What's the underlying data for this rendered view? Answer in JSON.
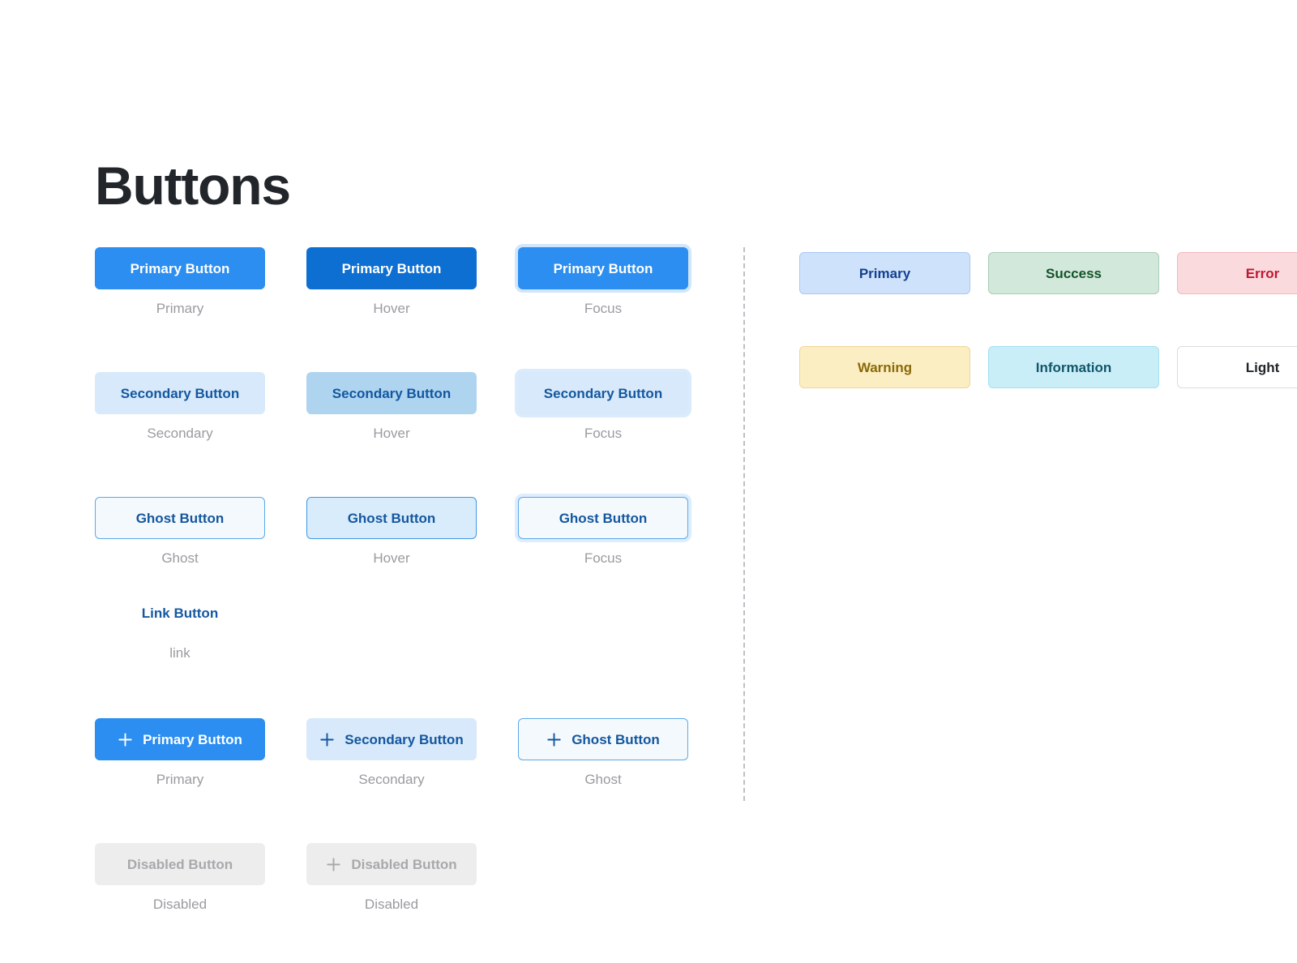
{
  "page": {
    "title": "Buttons",
    "background_color": "#ffffff",
    "title_color": "#22262b",
    "divider_color": "#bcbfc4"
  },
  "colors": {
    "primary": "#2b8ef0",
    "primary_hover": "#0d6fd1",
    "secondary_bg": "#d7e9fb",
    "secondary_hover_bg": "#aed4f0",
    "secondary_text": "#14579f",
    "ghost_bg": "#f4f9fe",
    "ghost_border": "#5ba8e8",
    "link_text": "#15589f",
    "disabled_bg": "#ededed",
    "disabled_text": "#a9a9ad",
    "caption_text": "#9a9ba0"
  },
  "button_groups": [
    {
      "name": "primary-states",
      "buttons": [
        {
          "label": "Primary Button",
          "caption": "Primary",
          "variant": "primary",
          "state": "default",
          "icon": null,
          "disabled": false
        },
        {
          "label": "Primary Button",
          "caption": "Hover",
          "variant": "primary",
          "state": "hover",
          "icon": null,
          "disabled": false
        },
        {
          "label": "Primary Button",
          "caption": "Focus",
          "variant": "primary",
          "state": "focus",
          "icon": null,
          "disabled": false
        }
      ]
    },
    {
      "name": "secondary-states",
      "buttons": [
        {
          "label": "Secondary Button",
          "caption": "Secondary",
          "variant": "secondary",
          "state": "default",
          "icon": null,
          "disabled": false
        },
        {
          "label": "Secondary Button",
          "caption": "Hover",
          "variant": "secondary",
          "state": "hover",
          "icon": null,
          "disabled": false
        },
        {
          "label": "Secondary Button",
          "caption": "Focus",
          "variant": "secondary",
          "state": "focus",
          "icon": null,
          "disabled": false
        }
      ]
    },
    {
      "name": "ghost-states",
      "buttons": [
        {
          "label": "Ghost Button",
          "caption": "Ghost",
          "variant": "ghost",
          "state": "default",
          "icon": null,
          "disabled": false
        },
        {
          "label": "Ghost Button",
          "caption": "Hover",
          "variant": "ghost",
          "state": "hover",
          "icon": null,
          "disabled": false
        },
        {
          "label": "Ghost Button",
          "caption": "Focus",
          "variant": "ghost",
          "state": "focus",
          "icon": null,
          "disabled": false
        }
      ]
    },
    {
      "name": "link-state",
      "buttons": [
        {
          "label": "Link Button",
          "caption": "link",
          "variant": "link",
          "state": "default",
          "icon": null,
          "disabled": false
        }
      ]
    },
    {
      "name": "icon-buttons",
      "buttons": [
        {
          "label": "Primary Button",
          "caption": "Primary",
          "variant": "primary",
          "state": "default",
          "icon": "plus-icon",
          "disabled": false
        },
        {
          "label": "Secondary Button",
          "caption": "Secondary",
          "variant": "secondary",
          "state": "default",
          "icon": "plus-icon",
          "disabled": false
        },
        {
          "label": "Ghost Button",
          "caption": "Ghost",
          "variant": "ghost",
          "state": "default",
          "icon": "plus-icon",
          "disabled": false
        }
      ]
    },
    {
      "name": "disabled-buttons",
      "buttons": [
        {
          "label": "Disabled Button",
          "caption": "Disabled",
          "variant": "disabled",
          "state": "disabled",
          "icon": null,
          "disabled": true
        },
        {
          "label": "Disabled Button",
          "caption": "Disabled",
          "variant": "disabled",
          "state": "disabled",
          "icon": "plus-icon",
          "disabled": true
        }
      ]
    }
  ],
  "status_badges": {
    "rows": [
      [
        {
          "label": "Primary",
          "variant": "primary",
          "bg": "#cfe2fc",
          "border": "#a9c8f4",
          "text": "#13418f"
        },
        {
          "label": "Success",
          "variant": "success",
          "bg": "#d2e8da",
          "border": "#a9cdb7",
          "text": "#14532a"
        },
        {
          "label": "Error",
          "variant": "error",
          "bg": "#fadadd",
          "border": "#f2b9bf",
          "text": "#c01730"
        }
      ],
      [
        {
          "label": "Warning",
          "variant": "warning",
          "bg": "#fbeec2",
          "border": "#efd796",
          "text": "#8a6a08"
        },
        {
          "label": "Information",
          "variant": "information",
          "bg": "#caeef7",
          "border": "#a3e0ef",
          "text": "#12566b"
        },
        {
          "label": "Light",
          "variant": "light",
          "bg": "#ffffff",
          "border": "#dcdcdc",
          "text": "#22262b"
        }
      ]
    ]
  }
}
